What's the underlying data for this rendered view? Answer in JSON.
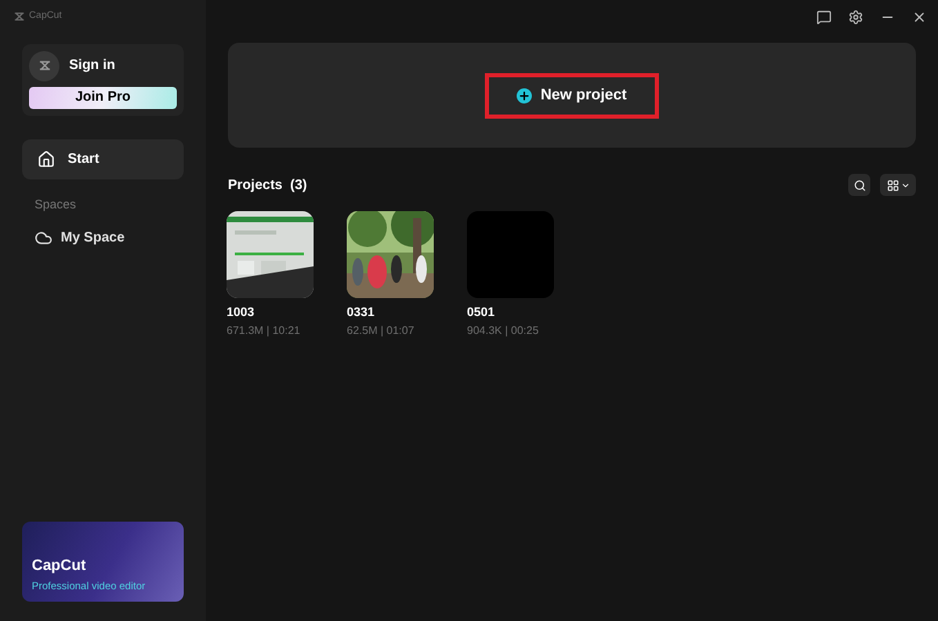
{
  "app": {
    "name": "CapCut"
  },
  "account": {
    "sign_in": "Sign in",
    "join_pro": "Join Pro"
  },
  "nav": [
    {
      "label": "Start",
      "selected": true,
      "kind": "home"
    }
  ],
  "spaces": {
    "heading": "Spaces",
    "items": [
      {
        "label": "My Space",
        "selected": false,
        "kind": "cloud"
      }
    ]
  },
  "promo": {
    "title": "CapCut",
    "subtitle": "Professional video editor"
  },
  "new_project": {
    "label": "New project",
    "highlighted": true
  },
  "projects": {
    "heading": "Projects",
    "count": "(3)",
    "items": [
      {
        "name": "1003",
        "meta": "671.3M | 10:21",
        "kind": "sheet"
      },
      {
        "name": "0331",
        "meta": "62.5M | 01:07",
        "kind": "picture"
      },
      {
        "name": "0501",
        "meta": "904.3K | 00:25",
        "kind": "blank"
      }
    ]
  }
}
